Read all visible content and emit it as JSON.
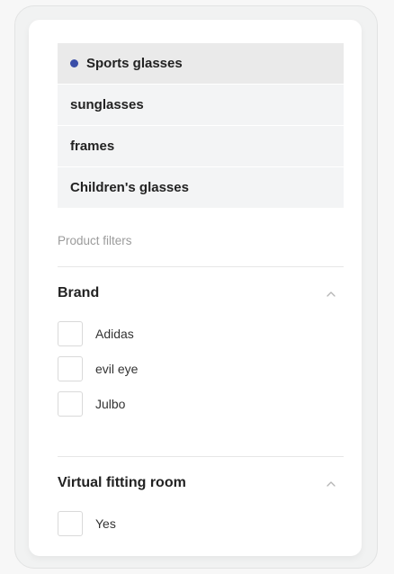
{
  "categories": [
    {
      "label": "Sports glasses",
      "selected": true
    },
    {
      "label": "sunglasses",
      "selected": false
    },
    {
      "label": "frames",
      "selected": false
    },
    {
      "label": "Children's glasses",
      "selected": false
    }
  ],
  "filters": {
    "heading": "Product filters",
    "brand": {
      "title": "Brand",
      "expanded": true,
      "options": [
        {
          "label": "Adidas",
          "checked": false
        },
        {
          "label": "evil eye",
          "checked": false
        },
        {
          "label": "Julbo",
          "checked": false
        }
      ]
    },
    "virtual_fitting": {
      "title": "Virtual fitting room",
      "expanded": true,
      "options": [
        {
          "label": "Yes",
          "checked": false
        }
      ]
    }
  },
  "icons": {
    "selected_marker": "dot-icon",
    "collapse": "chevron-up-icon"
  },
  "colors": {
    "accent_dot": "#3a4ea8",
    "selected_row": "#eaeaea",
    "row": "#f3f4f5"
  }
}
